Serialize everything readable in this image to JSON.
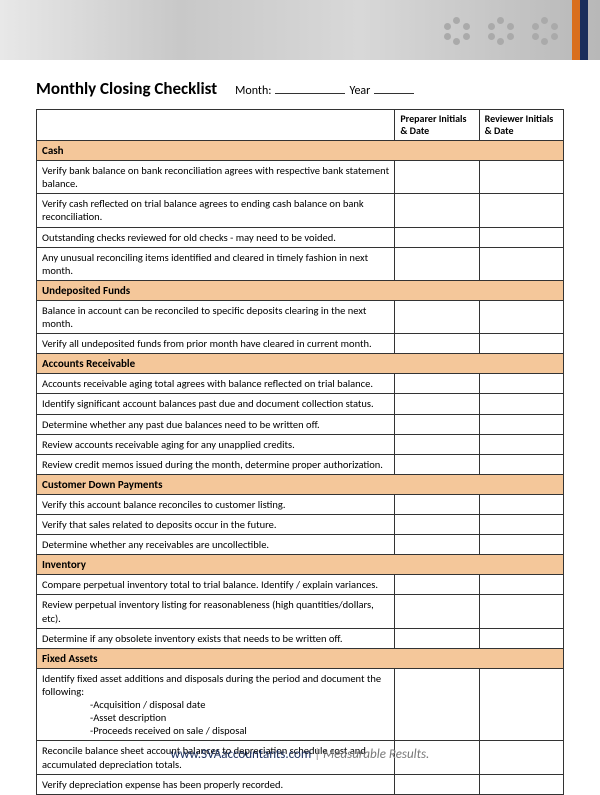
{
  "title": "Monthly Closing Checklist",
  "fields": {
    "month_label": "Month:",
    "year_label": "Year"
  },
  "columns": {
    "preparer": "Preparer Initials & Date",
    "reviewer": "Reviewer Initials & Date"
  },
  "sections": [
    {
      "name": "Cash",
      "items": [
        "Verify bank balance on bank reconciliation agrees with respective bank statement balance.",
        "Verify cash reflected on trial balance agrees to ending cash balance on bank reconciliation.",
        "Outstanding checks reviewed for old checks - may need to be voided.",
        "Any unusual reconciling items identified and cleared in timely fashion in next month."
      ]
    },
    {
      "name": "Undeposited Funds",
      "items": [
        "Balance in account can be reconciled to specific deposits clearing in the next month.",
        "Verify all undeposited funds from prior month have cleared in current month."
      ]
    },
    {
      "name": "Accounts Receivable",
      "items": [
        "Accounts receivable aging total agrees with balance reflected on trial balance.",
        "Identify significant account balances past due and document collection status.",
        "Determine whether any past due balances need to be written off.",
        "Review accounts receivable aging for any unapplied credits.",
        "Review credit memos issued during the month, determine proper authorization."
      ]
    },
    {
      "name": "Customer Down Payments",
      "items": [
        "Verify this account balance reconciles to customer listing.",
        "Verify that sales related to deposits occur in the future.",
        "Determine whether any receivables are uncollectible."
      ]
    },
    {
      "name": "Inventory",
      "items": [
        "Compare perpetual inventory total to trial balance.  Identify / explain variances.",
        "Review perpetual inventory listing for reasonableness (high quantities/dollars, etc).",
        "Determine if any obsolete inventory exists that needs to be written off."
      ]
    },
    {
      "name": "Fixed Assets",
      "items": [
        "Identify fixed asset additions and disposals during the period and document the following:\n-Acquisition / disposal date\n-Asset description\n-Proceeds received on sale / disposal",
        "Reconcile balance sheet account balances to depreciation schedule cost and accumulated depreciation totals.",
        "Verify depreciation expense has been properly recorded."
      ]
    }
  ],
  "footer": {
    "site": "www.SVAaccountants.com",
    "tagline": "Measurable Results."
  }
}
